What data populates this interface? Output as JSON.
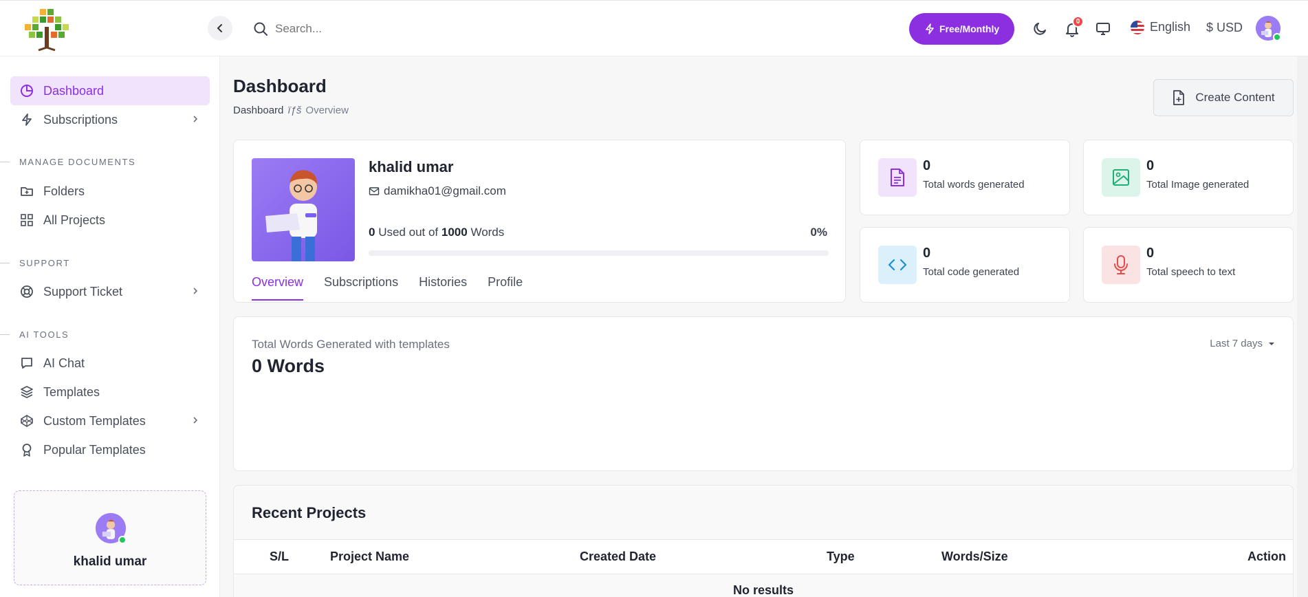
{
  "header": {
    "search_placeholder": "Search...",
    "plan_label": "Free/Monthly",
    "notification_count": "0",
    "language": "English",
    "currency": "$ USD"
  },
  "sidebar": {
    "items": [
      {
        "label": "Dashboard"
      },
      {
        "label": "Subscriptions"
      }
    ],
    "sections": [
      {
        "title": "MANAGE DOCUMENTS",
        "items": [
          {
            "label": "Folders"
          },
          {
            "label": "All Projects"
          }
        ]
      },
      {
        "title": "SUPPORT",
        "items": [
          {
            "label": "Support Ticket"
          }
        ]
      },
      {
        "title": "AI TOOLS",
        "items": [
          {
            "label": "AI Chat"
          },
          {
            "label": "Templates"
          },
          {
            "label": "Custom Templates"
          },
          {
            "label": "Popular Templates"
          }
        ]
      }
    ],
    "user_name": "khalid umar"
  },
  "page": {
    "title": "Dashboard",
    "breadcrumb": {
      "root": "Dashboard",
      "separator": "ïƒš",
      "current": "Overview"
    },
    "create_button": "Create Content"
  },
  "profile": {
    "name": "khalid umar",
    "email": "damikha01@gmail.com",
    "used": "0",
    "used_text": "Used out of",
    "total": "1000",
    "unit": "Words",
    "percent": "0%",
    "progress": 0,
    "tabs": [
      {
        "label": "Overview"
      },
      {
        "label": "Subscriptions"
      },
      {
        "label": "Histories"
      },
      {
        "label": "Profile"
      }
    ]
  },
  "stats": [
    {
      "value": "0",
      "label": "Total words generated",
      "icon": "document-icon",
      "color": "#8b2fe0",
      "bg": "#f0e3fb"
    },
    {
      "value": "0",
      "label": "Total Image generated",
      "icon": "image-icon",
      "color": "#1fae74",
      "bg": "#dcf5ea"
    },
    {
      "value": "0",
      "label": "Total code generated",
      "icon": "code-icon",
      "color": "#1b8fd6",
      "bg": "#dcf0fb"
    },
    {
      "value": "0",
      "label": "Total speech to text",
      "icon": "microphone-icon",
      "color": "#e54b4b",
      "bg": "#fbe3e3"
    }
  ],
  "words": {
    "label": "Total Words Generated with templates",
    "value": "0 Words",
    "range": "Last 7 days"
  },
  "projects": {
    "title": "Recent Projects",
    "columns": [
      "S/L",
      "Project Name",
      "Created Date",
      "Type",
      "Words/Size",
      "Action"
    ],
    "empty": "No results"
  },
  "colors": {
    "accent": "#8b2fe0",
    "active_bg": "#f0e3fb"
  }
}
